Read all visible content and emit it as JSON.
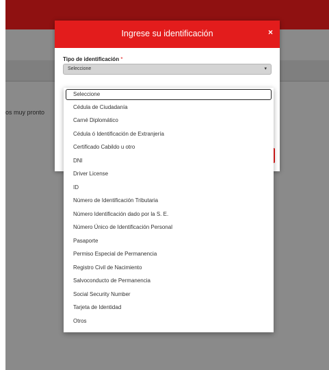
{
  "background": {
    "partial_text": "os muy pronto"
  },
  "modal": {
    "title": "Ingrese su identificación",
    "close_symbol": "×",
    "field_label": "Tipo de identificación",
    "required_mark": "*",
    "select_value": "Seleccione",
    "select_arrow": "▾"
  },
  "dropdown": {
    "options": [
      "Seleccione",
      "Cédula de Ciudadanía",
      "Carné Diplomático",
      "Cédula ó Identificación de Extranjería",
      "Certificado Cabildo u otro",
      "DNI",
      "Driver License",
      "ID",
      "Número de Identificación Tributaria",
      "Número Identificación dado por la S. E.",
      "Número Único de Identificación Personal",
      "Pasaporte",
      "Permiso Especial de Permanencia",
      "Registro Civil de Nacimiento",
      "Salvoconducto de Permanencia",
      "Social Security Number",
      "Tarjeta de Identidad",
      "Otros"
    ]
  },
  "colors": {
    "header_red": "#e31c1c",
    "page_header": "#8f1111",
    "overlay_gray": "#8a8a8a"
  }
}
